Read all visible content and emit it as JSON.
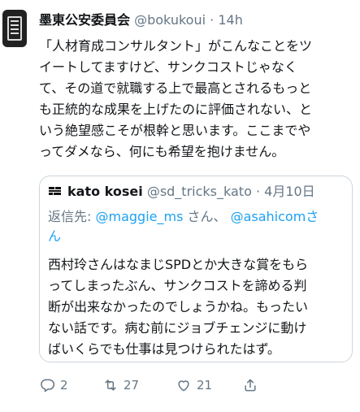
{
  "tweet": {
    "display_name": "墨東公安委員会",
    "handle": "@bokukoui",
    "separator": "·",
    "time": "14h",
    "lines": [
      "「人材育成コンサルタント」がこんなことをツ",
      "イートしてますけど、サンクコストじゃなく",
      "て、その道で就職する上で最高とされるもっと",
      "も正統的な成果を上げたのに評価されない、と",
      "いう絶望感こそが根幹と思います。ここまでや",
      "ってダメなら、何にも希望を抱けません。"
    ]
  },
  "quoted": {
    "display_name": "kato kosei",
    "handle": "@sd_tricks_kato",
    "separator": "·",
    "date": "4月10日",
    "reply_prefix": "返信先: ",
    "reply_mention1": "@maggie_ms",
    "reply_san1": " さん、 ",
    "reply_mention2": "@asahicomさ",
    "reply_line2": "ん",
    "lines": [
      "西村玲さんはなまじSPDとか大きな賞をもら",
      "ってしまったぶん、サンクコストを諦める判",
      "断が出来なかったのでしょうかね。もったい",
      "ない話です。病む前にジョブチェンジに動け",
      "ばいくらでも仕事は見つけられたはず。"
    ]
  },
  "actions": {
    "reply_count": "2",
    "retweet_count": "27",
    "like_count": "21"
  },
  "colors": {
    "text": "#14171a",
    "secondary": "#657786",
    "link": "#1da1f2",
    "border": "#ccd6dd"
  },
  "icons": [
    "reply-icon",
    "retweet-icon",
    "like-icon",
    "share-icon"
  ]
}
